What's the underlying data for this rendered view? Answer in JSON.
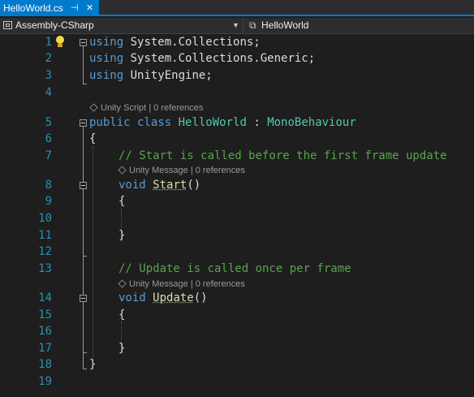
{
  "tab": {
    "title": "HelloWorld.cs",
    "pin": "⊣",
    "close": "✕"
  },
  "nav": {
    "project": "Assembly-CSharp",
    "class_icon": "class-icon",
    "class_name": "HelloWorld"
  },
  "line_numbers": [
    "1",
    "2",
    "3",
    "4",
    "5",
    "6",
    "7",
    "8",
    "9",
    "10",
    "11",
    "12",
    "13",
    "14",
    "15",
    "16",
    "17",
    "18",
    "19"
  ],
  "code": {
    "l1_kw": "using",
    "l1_rest": " System.Collections;",
    "l2_kw": "using",
    "l2_rest": " System.Collections.Generic;",
    "l3_kw": "using",
    "l3_rest": " UnityEngine;",
    "l5_kw1": "public",
    "l5_kw2": " class ",
    "l5_type": "HelloWorld",
    "l5_colon": " : ",
    "l5_base": "MonoBehaviour",
    "l6": "{",
    "l7_comment": "// Start is called before the first frame update",
    "l8_kw": "void",
    "l8_fn": "Start",
    "l8_rest": "()",
    "l9": "{",
    "l11": "}",
    "l13_comment": "// Update is called once per frame",
    "l14_kw": "void",
    "l14_fn": "Update",
    "l14_rest": "()",
    "l15": "{",
    "l17": "}",
    "l18": "}"
  },
  "codelens": {
    "class": {
      "kind": "Unity Script",
      "sep": "|",
      "refs": "0 references"
    },
    "start": {
      "kind": "Unity Message",
      "sep": "|",
      "refs": "0 references"
    },
    "update": {
      "kind": "Unity Message",
      "sep": "|",
      "refs": "0 references"
    }
  },
  "colors": {
    "accent": "#007acc",
    "keyword": "#569cd6",
    "type": "#4ec9b0",
    "comment": "#57a64a",
    "method": "#dcdcaa",
    "line_number": "#2b91af"
  }
}
